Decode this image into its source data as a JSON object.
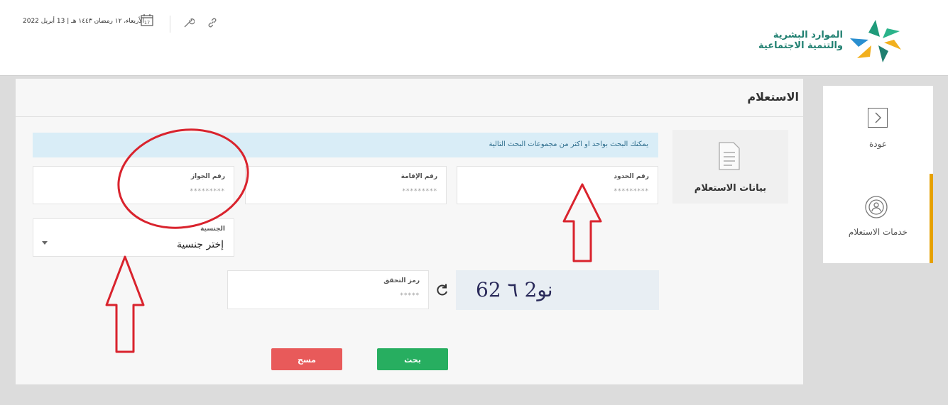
{
  "header": {
    "logo_line1": "الموارد البشرية",
    "logo_line2": "والتنمية الاجتماعية",
    "date": "الأربعاء، ١٢ رمضان ١٤٤٣ هـ | 13 أبريل 2022",
    "calendar_day": "17"
  },
  "sidebar": {
    "items": [
      {
        "label": "عودة",
        "icon": "chevron-right-icon"
      },
      {
        "label": "خدمات الاستعلام",
        "icon": "signal-user-icon"
      }
    ],
    "accent_color": "#e6a100"
  },
  "main": {
    "title": "الاستعلام",
    "tab_label": "بيانات الاستعلام",
    "info_text": "يمكنك البحث بواحد او اكثر من مجموعات البحث التالية",
    "fields": {
      "border_number": {
        "label": "رقم الحدود",
        "placeholder": "*********"
      },
      "iqama_number": {
        "label": "رقم الإقامة",
        "placeholder": "*********"
      },
      "passport_number": {
        "label": "رقم الجواز",
        "placeholder": "*********"
      },
      "nationality": {
        "label": "الجنسية",
        "value": "إختر جنسية"
      },
      "captcha": {
        "label": "رمز التحقق",
        "placeholder": "*****"
      }
    },
    "captcha_text": "62 نو2 ٦",
    "buttons": {
      "search": "بحث",
      "clear": "مسح"
    }
  },
  "colors": {
    "primary_green": "#27ae60",
    "danger_red": "#e85a5a",
    "info_bg": "#d9edf7",
    "annotation_red": "#d9232d"
  }
}
